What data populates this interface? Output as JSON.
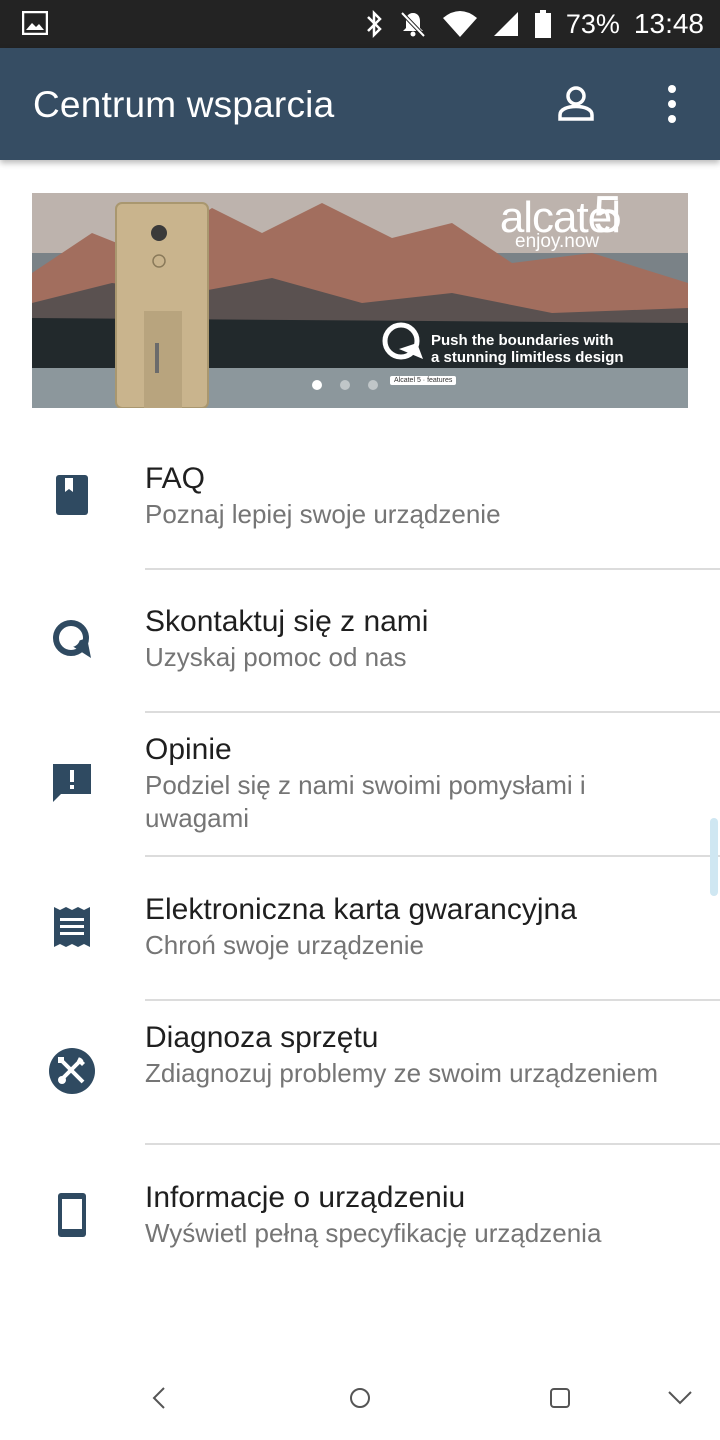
{
  "status_bar": {
    "battery_percent": "73%",
    "time": "13:48",
    "icons": [
      "image-icon",
      "bluetooth-icon",
      "notifications-off-icon",
      "wifi-icon",
      "signal-icon",
      "battery-icon"
    ]
  },
  "app_bar": {
    "title": "Centrum wsparcia",
    "icons": [
      "account-icon",
      "more-vert-icon"
    ]
  },
  "banner": {
    "brand": "alcatel",
    "brand_number": "5",
    "tagline": "enjoy.now",
    "promo_line1": "Push the boundaries with",
    "promo_line2": "a stunning limitless design",
    "chip": "Alcatel 5 · features",
    "slide_count": 3,
    "active_slide": 1
  },
  "menu": {
    "items": [
      {
        "title": "FAQ",
        "subtitle": "Poznaj lepiej swoje urządzenie",
        "icon": "book-icon"
      },
      {
        "title": "Skontaktuj się z nami",
        "subtitle": "Uzyskaj pomoc od nas",
        "icon": "chat-q-icon"
      },
      {
        "title": "Opinie",
        "subtitle": "Podziel się z nami swoimi pomysłami i uwagami",
        "icon": "feedback-icon"
      },
      {
        "title": "Elektroniczna karta gwarancyjna",
        "subtitle": "Chroń swoje urządzenie",
        "icon": "receipt-icon"
      },
      {
        "title": "Diagnoza sprzętu",
        "subtitle": "Zdiagnozuj problemy ze swoim urządzeniem",
        "icon": "tools-icon"
      },
      {
        "title": "Informacje o urządzeniu",
        "subtitle": "Wyświetl pełną specyfikację urządzenia",
        "icon": "phone-icon"
      }
    ]
  },
  "nav_bar": {
    "icons": [
      "back-icon",
      "home-icon",
      "recents-icon",
      "hide-nav-icon"
    ]
  },
  "colors": {
    "app_bar": "#364d63",
    "icon": "#2f4a61",
    "status_bar": "#232323"
  }
}
